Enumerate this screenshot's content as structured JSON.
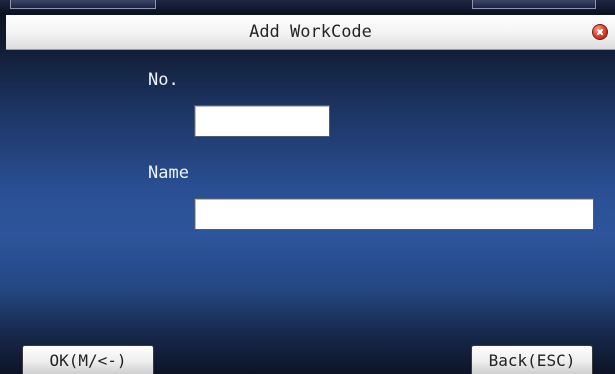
{
  "dialog": {
    "title": "Add WorkCode"
  },
  "form": {
    "number_label": "No.",
    "number_value": "",
    "name_label": "Name",
    "name_value": ""
  },
  "soft_keys": {
    "ok_label": "OK(M/<-)",
    "back_label": "Back(ESC)"
  },
  "icons": {
    "close": "close-icon"
  },
  "colors": {
    "background_top": "#0b0f1c",
    "background_mid": "#2d559c",
    "title_bar": "#f3f3f3",
    "close_icon": "#e24a2e",
    "label_text": "#eef2ff"
  }
}
